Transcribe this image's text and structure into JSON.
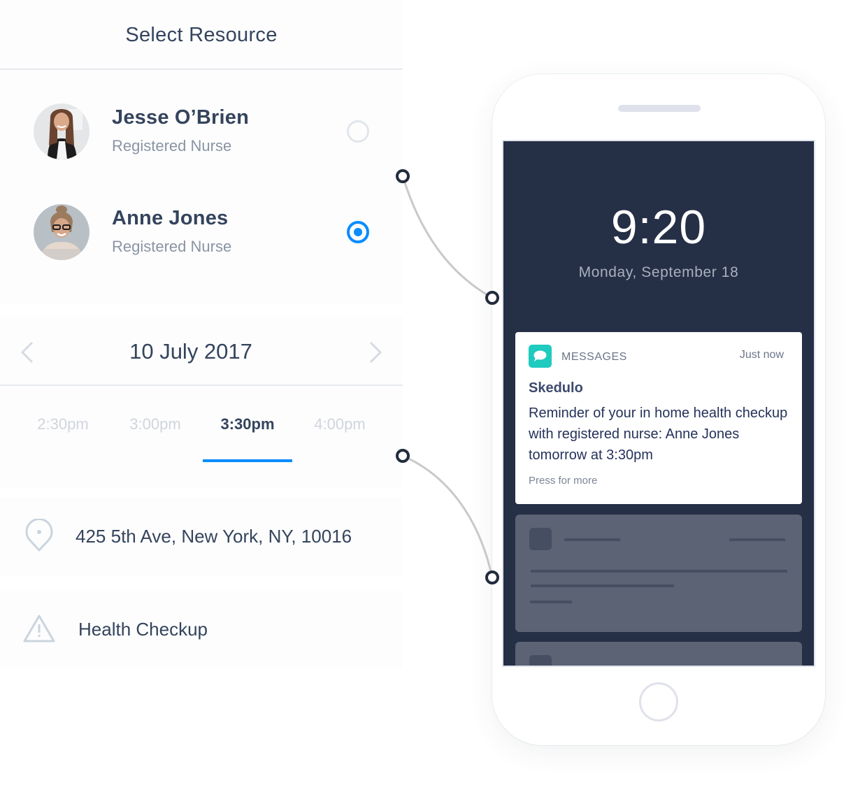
{
  "header": {
    "title": "Select Resource"
  },
  "resources": [
    {
      "name": "Jesse O’Brien",
      "role": "Registered Nurse",
      "selected": false,
      "avatar": "avatar-jesse"
    },
    {
      "name": "Anne Jones",
      "role": "Registered Nurse",
      "selected": true,
      "avatar": "avatar-anne"
    }
  ],
  "date_picker": {
    "date": "10 July 2017",
    "prev_icon": "chevron-left-icon",
    "next_icon": "chevron-right-icon"
  },
  "time_slots": [
    {
      "label": "2:30pm",
      "active": false
    },
    {
      "label": "3:00pm",
      "active": false
    },
    {
      "label": "3:30pm",
      "active": true
    },
    {
      "label": "4:00pm",
      "active": false
    }
  ],
  "details": {
    "address": {
      "icon": "location-pin-icon",
      "text": "425 5th Ave, New York, NY, 10016"
    },
    "service": {
      "icon": "warning-triangle-icon",
      "text": "Health Checkup"
    }
  },
  "phone": {
    "time": "9:20",
    "date": "Monday, September 18",
    "notification": {
      "app_icon": "message-bubble-icon",
      "app_name": "MESSAGES",
      "timestamp": "Just now",
      "title": "Skedulo",
      "body": "Reminder of your in home health checkup with registered nurse: Anne Jones tomorrow at 3:30pm",
      "action": "Press for more"
    }
  },
  "colors": {
    "accent": "#0a8cff",
    "text_primary": "#34445c",
    "text_secondary": "#8a94a3",
    "phone_screen": "#252f46",
    "messages_app": "#1fcabe"
  }
}
